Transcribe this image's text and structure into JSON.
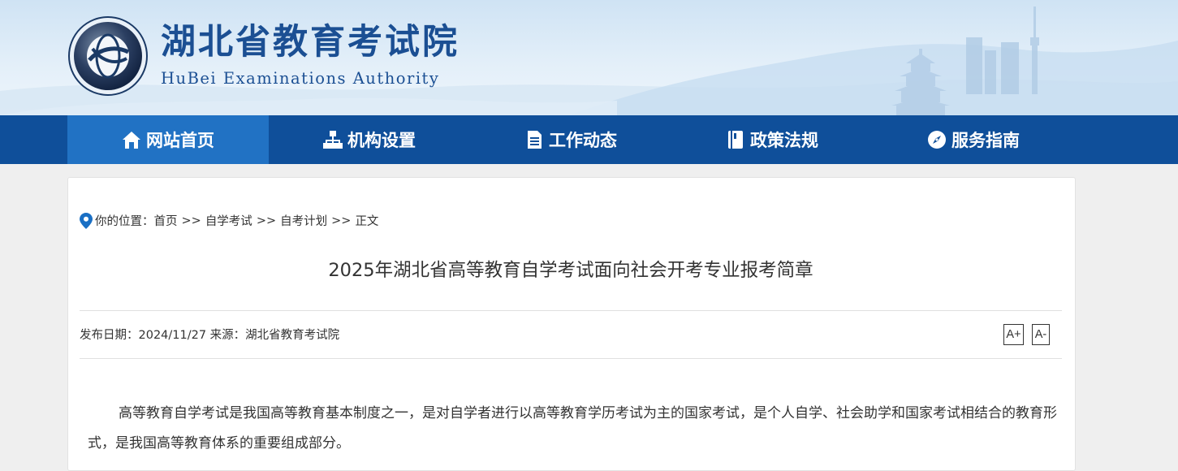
{
  "header": {
    "title": "湖北省教育考试院",
    "subtitle": "HuBei Examinations Authority",
    "logo": {
      "ring_text": "HBEA",
      "bottom_text": "湖北考试"
    }
  },
  "nav": {
    "items": [
      {
        "label": "网站首页",
        "icon": "home-icon",
        "active": true
      },
      {
        "label": "机构设置",
        "icon": "org-chart-icon",
        "active": false
      },
      {
        "label": "工作动态",
        "icon": "document-icon",
        "active": false
      },
      {
        "label": "政策法规",
        "icon": "book-icon",
        "active": false
      },
      {
        "label": "服务指南",
        "icon": "compass-icon",
        "active": false
      }
    ]
  },
  "breadcrumb": {
    "prefix": "你的位置：",
    "items": [
      "首页",
      "自学考试",
      "自考计划",
      "正文"
    ],
    "separator": ">>"
  },
  "article": {
    "title": "2025年湖北省高等教育自学考试面向社会开考专业报考简章",
    "meta": "发布日期：2024/11/27 来源：湖北省教育考试院",
    "font_increase": "A+",
    "font_decrease": "A-",
    "paragraph": "高等教育自学考试是我国高等教育基本制度之一，是对自学者进行以高等教育学历考试为主的国家考试，是个人自学、社会助学和国家考试相结合的教育形式，是我国高等教育体系的重要组成部分。"
  },
  "colors": {
    "nav_bg": "#0f4f9a",
    "nav_active": "#2172c4",
    "title_blue": "#1b4f93",
    "pin_blue": "#1a6fc4"
  }
}
